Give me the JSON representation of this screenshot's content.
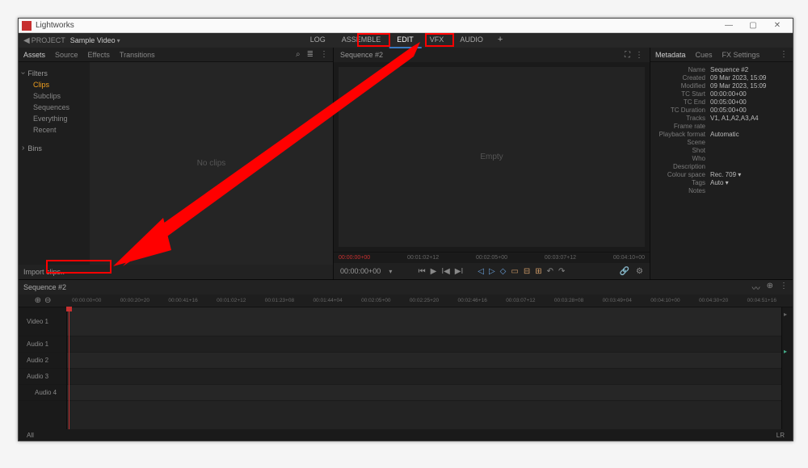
{
  "app": {
    "title": "Lightworks"
  },
  "project": {
    "label": "PROJECT",
    "name": "Sample Video"
  },
  "modes": {
    "log": "LOG",
    "assemble": "ASSEMBLE",
    "edit": "EDIT",
    "vfx": "VFX",
    "audio": "AUDIO"
  },
  "assets_panel": {
    "tabs": {
      "assets": "Assets",
      "source": "Source",
      "effects": "Effects",
      "transitions": "Transitions"
    },
    "tree": {
      "filters_label": "Filters",
      "items": [
        "Clips",
        "Subclips",
        "Sequences",
        "Everything",
        "Recent"
      ],
      "bins_label": "Bins"
    },
    "empty_text": "No clips",
    "import_label": "Import clips.."
  },
  "viewer": {
    "title": "Sequence #2",
    "empty_text": "Empty",
    "ruler_tcs": [
      "00:00:00+00",
      "00:01:02+12",
      "00:02:05+00",
      "00:03:07+12",
      "00:04:10+00"
    ],
    "current_tc": "00:00:00+00"
  },
  "metadata_panel": {
    "tabs": {
      "metadata": "Metadata",
      "cues": "Cues",
      "fx": "FX Settings"
    },
    "rows": [
      {
        "k": "Name",
        "v": "Sequence #2"
      },
      {
        "k": "Created",
        "v": "09 Mar 2023, 15:09"
      },
      {
        "k": "Modified",
        "v": "09 Mar 2023, 15:09"
      },
      {
        "k": "TC Start",
        "v": "00:00:00+00"
      },
      {
        "k": "TC End",
        "v": "00:05:00+00"
      },
      {
        "k": "TC Duration",
        "v": "00:05:00+00"
      },
      {
        "k": "Tracks",
        "v": "V1, A1,A2,A3,A4"
      },
      {
        "k": "Frame rate",
        "v": ""
      },
      {
        "k": "Playback format",
        "v": "Automatic"
      },
      {
        "k": "Scene",
        "v": ""
      },
      {
        "k": "Shot",
        "v": ""
      },
      {
        "k": "Who",
        "v": ""
      },
      {
        "k": "Description",
        "v": ""
      },
      {
        "k": "Colour space",
        "v": "Rec. 709 ▾"
      },
      {
        "k": "Tags",
        "v": "Auto ▾"
      },
      {
        "k": "Notes",
        "v": ""
      }
    ]
  },
  "timeline": {
    "title": "Sequence #2",
    "ruler": [
      "00:00:00+00",
      "00:00:20+20",
      "00:00:41+16",
      "00:01:02+12",
      "00:01:23+08",
      "00:01:44+04",
      "00:02:05+00",
      "00:02:25+20",
      "00:02:46+16",
      "00:03:07+12",
      "00:03:28+08",
      "00:03:49+04",
      "00:04:10+00",
      "00:04:30+20",
      "00:04:51+16"
    ],
    "tracks": {
      "v1": "Video 1",
      "a1": "Audio 1",
      "a2": "Audio 2",
      "a3": "Audio 3",
      "a4": "Audio 4",
      "all": "All",
      "lr": "LR"
    }
  }
}
